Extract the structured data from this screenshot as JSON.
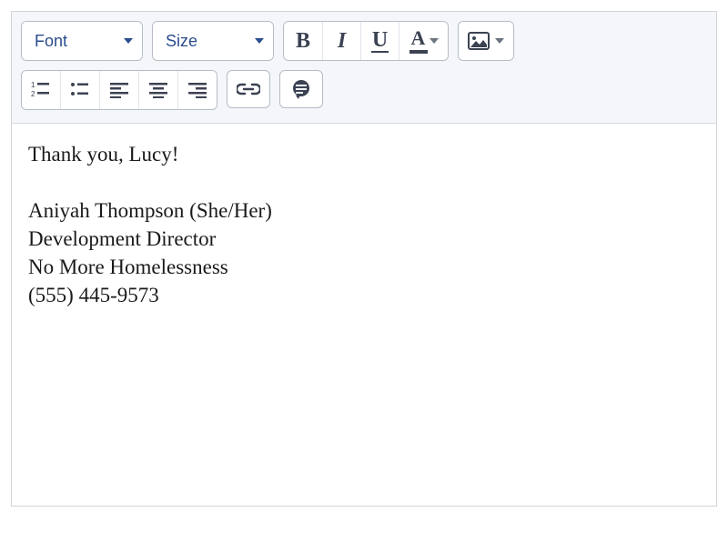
{
  "toolbar": {
    "font_label": "Font",
    "size_label": "Size"
  },
  "content": {
    "line1": "Thank you, Lucy!",
    "sig_name": "Aniyah Thompson (She/Her)",
    "sig_title": "Development Director",
    "sig_org": "No More Homelessness",
    "sig_phone": "(555) 445-9573"
  }
}
